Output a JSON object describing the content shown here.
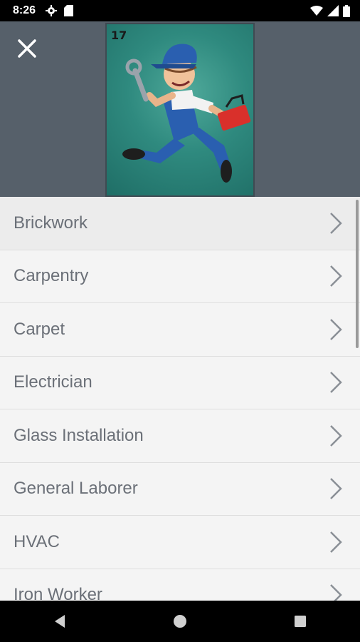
{
  "status": {
    "time": "8:26",
    "icons": [
      "settings-icon",
      "sd-card-icon",
      "wifi-icon",
      "signal-icon",
      "battery-icon"
    ]
  },
  "header": {
    "close_icon": "close-icon",
    "badge_number": "17",
    "background": "#56606a"
  },
  "trades": {
    "items": [
      {
        "label": "Brickwork"
      },
      {
        "label": "Carpentry"
      },
      {
        "label": "Carpet"
      },
      {
        "label": "Electrician"
      },
      {
        "label": "Glass Installation"
      },
      {
        "label": "General Laborer"
      },
      {
        "label": "HVAC"
      },
      {
        "label": "Iron Worker"
      }
    ],
    "chevron_icon": "chevron-right-icon"
  },
  "nav": {
    "icons": [
      "back-icon",
      "home-icon",
      "recents-icon"
    ]
  }
}
